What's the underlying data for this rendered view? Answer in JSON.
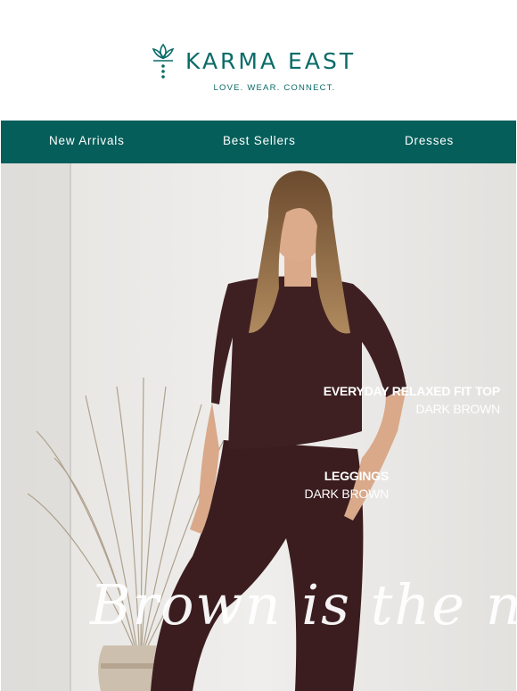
{
  "header": {
    "brand": "KARMA EAST",
    "tagline": "LOVE. WEAR. CONNECT.",
    "logo_icon": "lotus-icon"
  },
  "nav": {
    "items": [
      {
        "label": "New Arrivals"
      },
      {
        "label": "Best Sellers"
      },
      {
        "label": "Dresses"
      }
    ]
  },
  "hero": {
    "product1": {
      "name": "EVERYDAY RELAXED FIT TOP",
      "color": "DARK BROWN"
    },
    "product2": {
      "name": "LEGGINGS",
      "color": "DARK BROWN"
    },
    "headline": "Brown is the new"
  },
  "colors": {
    "brand_teal": "#0a6b68",
    "nav_bg": "#055e5a",
    "garment": "#3b1d1f"
  }
}
